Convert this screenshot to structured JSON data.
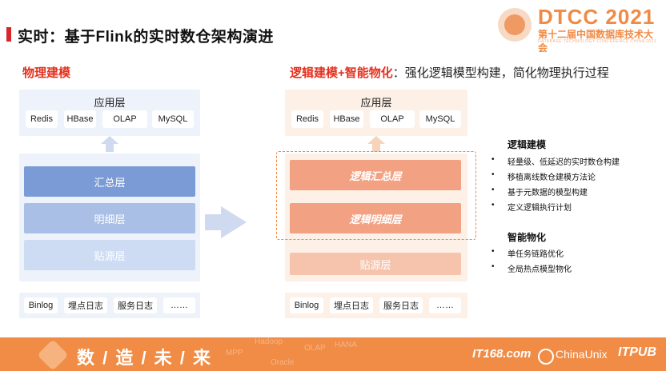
{
  "title": "实时：基于Flink的实时数仓架构演进",
  "logo": {
    "main": "DTCC 2021",
    "sub": "第十二届中国数据库技术大会",
    "en": "DATABASE TECHNOLOGY CONFERENCE CHINA 2021"
  },
  "left": {
    "heading": "物理建模",
    "app_layer": "应用层",
    "apps": [
      "Redis",
      "HBase",
      "OLAP",
      "MySQL"
    ],
    "layers": [
      "汇总层",
      "明细层",
      "贴源层"
    ],
    "sources": [
      "Binlog",
      "埋点日志",
      "服务日志",
      "……"
    ]
  },
  "right": {
    "heading_red": "逻辑建模+智能物化",
    "heading_rest": "：强化逻辑模型构建，简化物理执行过程",
    "app_layer": "应用层",
    "apps": [
      "Redis",
      "HBase",
      "OLAP",
      "MySQL"
    ],
    "logical_layers": [
      "逻辑汇总层",
      "逻辑明细层"
    ],
    "source_layer": "贴源层",
    "sources": [
      "Binlog",
      "埋点日志",
      "服务日志",
      "……"
    ]
  },
  "side": {
    "logic_head": "逻辑建模",
    "logic_items": [
      "轻量级、低延迟的实时数仓构建",
      "移植离线数仓建模方法论",
      "基于元数据的模型构建",
      "定义逻辑执行计划"
    ],
    "mat_head": "智能物化",
    "mat_items": [
      "单任务链路优化",
      "全局热点模型物化"
    ]
  },
  "footer": {
    "slogan": "数 / 造 / 未 / 来",
    "brands": [
      "IT168.com",
      "ChinaUnix",
      "ITPUB"
    ],
    "watermarks": [
      "Hadoop",
      "OLAP",
      "HANA",
      "Oracle",
      "MPP"
    ]
  },
  "colors": {
    "accent": "#f08c45",
    "title_red": "#d9262c",
    "blue_dark": "#7b9bd6",
    "blue_mid": "#a9bfe6",
    "blue_light": "#cddcf3",
    "orange_dark": "#f2a183",
    "orange_light": "#f6c4ad"
  }
}
